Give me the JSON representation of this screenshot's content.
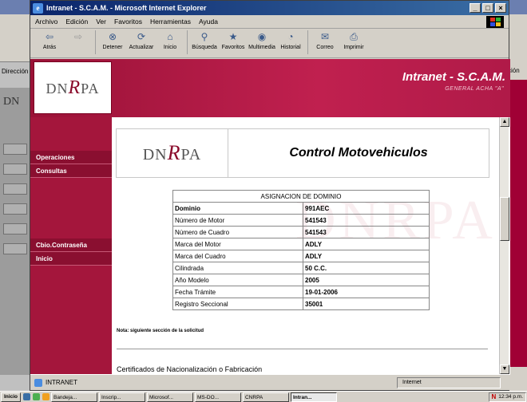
{
  "window": {
    "title": "Intranet - S.C.A.M. - Microsoft Internet Explorer",
    "buttons": [
      "_",
      "□",
      "×"
    ]
  },
  "menu": [
    "Archivo",
    "Edición",
    "Ver",
    "Favoritos",
    "Herramientas",
    "Ayuda"
  ],
  "toolbar": [
    {
      "label": "Atrás",
      "icon": "back-icon",
      "glyph": "⇦"
    },
    {
      "label": "",
      "icon": "forward-icon",
      "glyph": "⇨"
    },
    {
      "label": "Detener",
      "icon": "stop-icon",
      "glyph": "⊗"
    },
    {
      "label": "Actualizar",
      "icon": "refresh-icon",
      "glyph": "⟳"
    },
    {
      "label": "Inicio",
      "icon": "home-icon",
      "glyph": "⌂"
    },
    {
      "label": "Búsqueda",
      "icon": "search-icon",
      "glyph": "⚲"
    },
    {
      "label": "Favoritos",
      "icon": "favorites-icon",
      "glyph": "★"
    },
    {
      "label": "Multimedia",
      "icon": "media-icon",
      "glyph": "◉"
    },
    {
      "label": "Historial",
      "icon": "history-icon",
      "glyph": "◔"
    },
    {
      "label": "Correo",
      "icon": "mail-icon",
      "glyph": "✉"
    },
    {
      "label": "Imprimir",
      "icon": "print-icon",
      "glyph": "⎙"
    }
  ],
  "header": {
    "logo_text_dn": "DN",
    "logo_text_r": "R",
    "logo_text_pa": "PA",
    "title": "Intranet - S.C.A.M.",
    "subtitle": "GENERAL ACHA \"A\""
  },
  "sidebar": {
    "items": [
      {
        "label": "Operaciones",
        "name": "sidebar-item-operaciones"
      },
      {
        "label": "Consultas",
        "name": "sidebar-item-consultas"
      },
      {
        "label": "Cbio.Contraseña",
        "name": "sidebar-item-cambio-contrasena"
      },
      {
        "label": "Inicio",
        "name": "sidebar-item-inicio"
      }
    ]
  },
  "page": {
    "title": "Control Motovehiculos",
    "watermark": "DNRPA",
    "table_header": "ASIGNACION DE DOMINIO",
    "rows": [
      {
        "label": "Dominio",
        "value": "991AEC"
      },
      {
        "label": "Número de Motor",
        "value": "541543"
      },
      {
        "label": "Número de Cuadro",
        "value": "541543"
      },
      {
        "label": "Marca del Motor",
        "value": "ADLY"
      },
      {
        "label": "Marca del Cuadro",
        "value": "ADLY"
      },
      {
        "label": "Cilindrada",
        "value": "50 C.C."
      },
      {
        "label": "Año Modelo",
        "value": "2005"
      },
      {
        "label": "Fecha Trámite",
        "value": "19-01-2006"
      },
      {
        "label": "Registro Seccional",
        "value": "35001"
      }
    ],
    "note": "Nota: siguiente sección de la solicitud",
    "certificates_heading": "Certificados de Nacionalización o Fabricación"
  },
  "status": {
    "left": "INTRANET",
    "zone": "Internet"
  },
  "taskbar": {
    "start": "Inicio",
    "tasks": [
      "Bandeja...",
      "Inscrip...",
      "Microsof...",
      "MS-DO...",
      "CNRPA",
      "Intran..."
    ],
    "tray_n": "N",
    "clock": "12:34 p.m."
  },
  "background": {
    "left_label": "Dirección",
    "right_label": "ción"
  }
}
